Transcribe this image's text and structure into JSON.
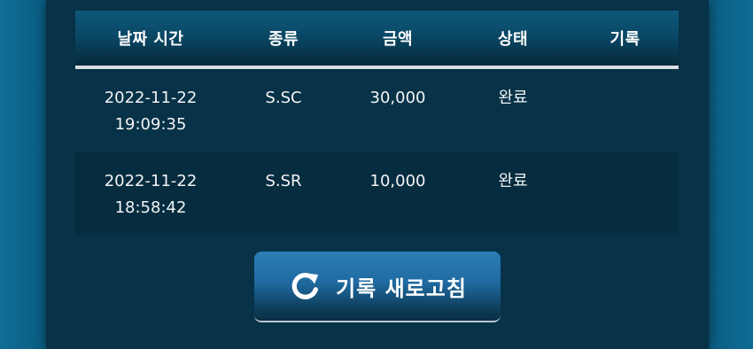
{
  "history_table": {
    "headers": [
      "날짜 시간",
      "종류",
      "금액",
      "상태",
      "기록"
    ],
    "rows": [
      {
        "date": "2022-11-22",
        "time": "19:09:35",
        "type": "S.SC",
        "amount": "30,000",
        "status": "완료",
        "record": ""
      },
      {
        "date": "2022-11-22",
        "time": "18:58:42",
        "type": "S.SR",
        "amount": "10,000",
        "status": "완료",
        "record": ""
      }
    ]
  },
  "refresh_button": {
    "label": "기록 새로고침",
    "icon": "refresh-icon"
  },
  "colors": {
    "background": "#07486a",
    "panel": "#073247",
    "header": "#0a4866",
    "button": "#1f6aa0",
    "text": "#ffffff"
  }
}
